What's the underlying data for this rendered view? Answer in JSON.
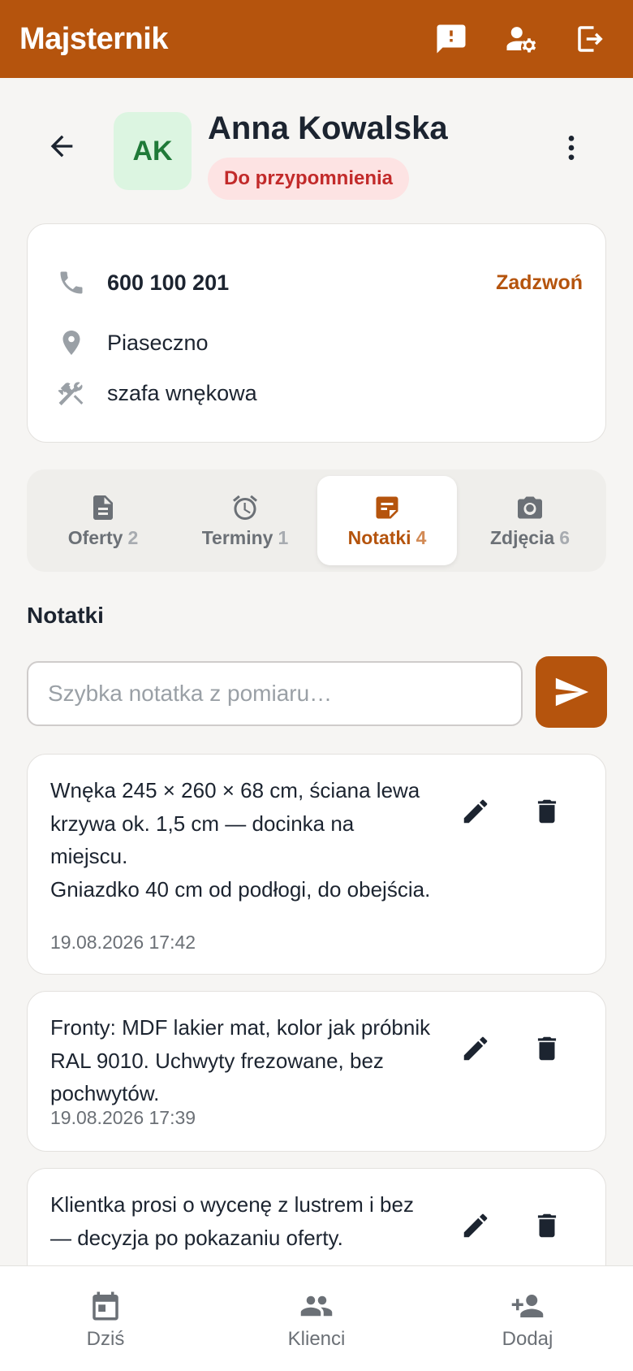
{
  "app": {
    "title": "Majsternik"
  },
  "topbar": {
    "icons": [
      "feedback-icon",
      "user-settings-icon",
      "logout-icon"
    ]
  },
  "client": {
    "initials": "AK",
    "name": "Anna Kowalska",
    "status": "Do przypomnienia",
    "phone": "600 100 201",
    "call_label": "Zadzwoń",
    "location": "Piaseczno",
    "job": "szafa wnękowa"
  },
  "tabs": [
    {
      "label": "Oferty",
      "count": "2",
      "icon": "document-icon",
      "active": false
    },
    {
      "label": "Terminy",
      "count": "1",
      "icon": "alarm-icon",
      "active": false
    },
    {
      "label": "Notatki",
      "count": "4",
      "icon": "note-icon",
      "active": true
    },
    {
      "label": "Zdjęcia",
      "count": "6",
      "icon": "camera-icon",
      "active": false
    }
  ],
  "notes_section": {
    "title": "Notatki",
    "input_placeholder": "Szybka notatka z pomiaru…",
    "input_value": ""
  },
  "notes": [
    {
      "text": "Wnęka 245 × 260 × 68 cm, ściana lewa krzywa ok. 1,5 cm — docinka na miejscu.\nGniazdko 40 cm od podłogi, do obejścia.",
      "date": "19.08.2026 17:42"
    },
    {
      "text": "Fronty: MDF lakier mat, kolor jak próbnik RAL 9010. Uchwyty frezowane, bez pochwytów.",
      "date": "19.08.2026 17:39"
    },
    {
      "text": "Klientka prosi o wycenę z lustrem i bez — decyzja po pokazaniu oferty.",
      "date": ""
    }
  ],
  "bottom_nav": [
    {
      "label": "Dziś",
      "icon": "calendar-icon"
    },
    {
      "label": "Klienci",
      "icon": "people-icon"
    },
    {
      "label": "Dodaj",
      "icon": "add-person-icon"
    }
  ],
  "colors": {
    "brand": "#b5540d",
    "status_bg": "#fde3e3",
    "status_text": "#c22a2a",
    "avatar_bg": "#dcf5e1",
    "avatar_text": "#1f7a38"
  }
}
